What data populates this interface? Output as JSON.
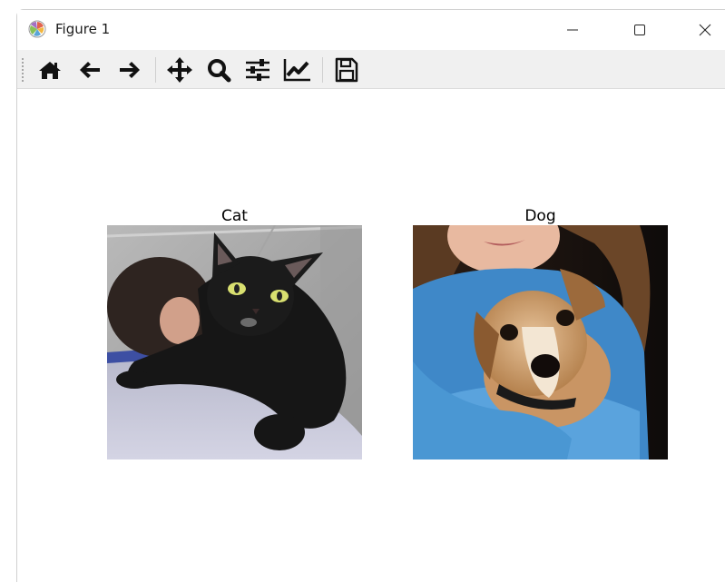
{
  "window": {
    "title": "Figure 1",
    "app_icon": "matplotlib-logo-icon",
    "controls": [
      "minimize-icon",
      "maximize-icon",
      "close-icon"
    ]
  },
  "toolbar": {
    "buttons": [
      {
        "name": "home-icon"
      },
      {
        "name": "back-arrow-icon"
      },
      {
        "name": "forward-arrow-icon"
      },
      {
        "name": "pan-move-icon"
      },
      {
        "name": "zoom-magnifier-icon"
      },
      {
        "name": "configure-subplots-icon"
      },
      {
        "name": "edit-axis-icon"
      },
      {
        "name": "save-floppy-icon"
      }
    ]
  },
  "figure": {
    "subplots": [
      {
        "title": "Cat",
        "image": "black cat held on a person's shoulder"
      },
      {
        "title": "Dog",
        "image": "tan and white puppy held by a girl"
      }
    ]
  }
}
